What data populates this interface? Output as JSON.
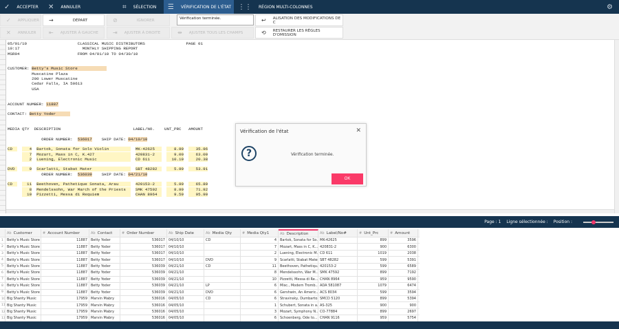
{
  "topbar": {
    "accept": "Accepter",
    "cancel": "Annuler",
    "selection": "Sélection",
    "status_check": "Vérification de l'état",
    "multi_column": "Région multi-colonnes"
  },
  "toolbar": {
    "apply": "Appliquer",
    "start": "Départ",
    "ignore": "Ignorer",
    "status_value": "Vérification terminée.",
    "view_changes": "ALISATION DES MODIFICATIONS DE C",
    "cancel": "Annuler",
    "align_left": "Ajuster à gauche",
    "align_right": "Ajuster à droite",
    "align_all": "Ajuster tous les champs",
    "restore_rules": "Restaurer les règles d'omission"
  },
  "report": [
    [
      [
        "05/01/10                     CLASSICAL MUSIC DISTRIBUTORS                 PAGE 01",
        ""
      ]
    ],
    [
      [
        "10:17                          MONTHLY SHIPPING REPORT",
        ""
      ]
    ],
    [
      [
        "MSR94                        FROM 04/01/10 TO 04/30/10",
        ""
      ]
    ],
    [
      [
        "",
        ""
      ]
    ],
    [
      [
        "",
        ""
      ]
    ],
    [
      [
        "CUSTOMER: ",
        ""
      ],
      [
        "Betty's Music Store            ",
        "hp"
      ]
    ],
    [
      [
        "          Muscatine Plaza",
        ""
      ]
    ],
    [
      [
        "          200 Lower Muscatine",
        ""
      ]
    ],
    [
      [
        "          Cedar Falls, IA 50613",
        ""
      ]
    ],
    [
      [
        "          USA",
        ""
      ]
    ],
    [
      [
        "",
        ""
      ]
    ],
    [
      [
        "",
        ""
      ]
    ],
    [
      [
        "ACCOUNT NUMBER: ",
        ""
      ],
      [
        "11887",
        "hp"
      ]
    ],
    [
      [
        "",
        ""
      ]
    ],
    [
      [
        "CONTACT: ",
        ""
      ],
      [
        "Betty Yoder      ",
        "hp"
      ]
    ],
    [
      [
        "",
        ""
      ]
    ],
    [
      [
        "",
        ""
      ]
    ],
    [
      [
        "MEDIA QTY  DESCRIPTION                              LABEL/NO.    UNT_PRC   AMOUNT",
        ""
      ]
    ],
    [
      [
        "",
        ""
      ]
    ],
    [
      [
        "              ORDER NUMBER:  ",
        ""
      ],
      [
        "536017",
        "hp"
      ],
      [
        "    SHIP DATE: ",
        ""
      ],
      [
        "04/10/10",
        "hp"
      ]
    ],
    [
      [
        "",
        ""
      ]
    ],
    [
      [
        "CD  ",
        "hy"
      ],
      [
        "  ",
        ""
      ],
      [
        "   4",
        "hy"
      ],
      [
        "  ",
        ""
      ],
      [
        "Bartok, Sonata for Solo Violin         ",
        "hy"
      ],
      [
        "  ",
        ""
      ],
      [
        "MK-42625   ",
        "hy"
      ],
      [
        "  ",
        ""
      ],
      [
        "   8.99",
        "hy"
      ],
      [
        "  ",
        ""
      ],
      [
        "   35.96",
        "hy"
      ]
    ],
    [
      [
        "    ",
        ""
      ],
      [
        "  ",
        ""
      ],
      [
        "   7",
        "hy"
      ],
      [
        "  ",
        ""
      ],
      [
        "Mozart, Mass in C, K.427               ",
        "hy"
      ],
      [
        "  ",
        ""
      ],
      [
        "420831-2   ",
        "hy"
      ],
      [
        "  ",
        ""
      ],
      [
        "   9.00",
        "hy"
      ],
      [
        "  ",
        ""
      ],
      [
        "   63.00",
        "hy"
      ]
    ],
    [
      [
        "    ",
        ""
      ],
      [
        "  ",
        ""
      ],
      [
        "   2",
        "hy"
      ],
      [
        "  ",
        ""
      ],
      [
        "Luening, Electronic Music              ",
        "hy"
      ],
      [
        "  ",
        ""
      ],
      [
        "CD 611     ",
        "hy"
      ],
      [
        "  ",
        ""
      ],
      [
        "  10.19",
        "hy"
      ],
      [
        "  ",
        ""
      ],
      [
        "   20.38",
        "hy"
      ]
    ],
    [
      [
        "",
        ""
      ]
    ],
    [
      [
        "DVD ",
        "hy"
      ],
      [
        "  ",
        ""
      ],
      [
        "   9",
        "hy"
      ],
      [
        "  ",
        ""
      ],
      [
        "Scarlatti, Stabat Mater                ",
        "hy"
      ],
      [
        "  ",
        ""
      ],
      [
        "SBT 48282  ",
        "hy"
      ],
      [
        "  ",
        ""
      ],
      [
        "   5.99",
        "hy"
      ],
      [
        "  ",
        ""
      ],
      [
        "   53.91",
        "hy"
      ]
    ],
    [
      [
        "              ORDER NUMBER:  ",
        ""
      ],
      [
        "536039",
        "hp"
      ],
      [
        "    SHIP DATE: ",
        ""
      ],
      [
        "04/21/10",
        "hp"
      ]
    ],
    [
      [
        "",
        ""
      ]
    ],
    [
      [
        "CD  ",
        "hy"
      ],
      [
        "  ",
        ""
      ],
      [
        "  11",
        "hy"
      ],
      [
        "  ",
        ""
      ],
      [
        "Beethoven, Pathetique Sonata, Arau     ",
        "hy"
      ],
      [
        "  ",
        ""
      ],
      [
        "420153-2   ",
        "hy"
      ],
      [
        "  ",
        ""
      ],
      [
        "   5.99",
        "hy"
      ],
      [
        "  ",
        ""
      ],
      [
        "   65.89",
        "hy"
      ]
    ],
    [
      [
        "    ",
        ""
      ],
      [
        "  ",
        ""
      ],
      [
        "   8",
        "hy"
      ],
      [
        "  ",
        ""
      ],
      [
        "Mendelssohn, War March of the Priests  ",
        "hy"
      ],
      [
        "  ",
        ""
      ],
      [
        "SMK 47592  ",
        "hy"
      ],
      [
        "  ",
        ""
      ],
      [
        "   8.99",
        "hy"
      ],
      [
        "  ",
        ""
      ],
      [
        "   71.92",
        "hy"
      ]
    ],
    [
      [
        "    ",
        ""
      ],
      [
        "  ",
        ""
      ],
      [
        "  10",
        "hy"
      ],
      [
        "  ",
        ""
      ],
      [
        "Pizzetti, Messa di Requiem             ",
        "hy"
      ],
      [
        "  ",
        ""
      ],
      [
        "CHAN 8964  ",
        "hy"
      ],
      [
        "  ",
        ""
      ],
      [
        "   9.59",
        "hy"
      ],
      [
        "  ",
        ""
      ],
      [
        "   95.90",
        "hy"
      ]
    ]
  ],
  "dialog": {
    "title": "Vérification de l'état",
    "message": "Vérification terminée.",
    "ok": "OK"
  },
  "status": {
    "page": "Page : 1",
    "selected_row": "Ligne sélectionnée :",
    "position": "Position :"
  },
  "grid": {
    "columns": [
      {
        "t": "Ab",
        "n": "Customer"
      },
      {
        "t": "#",
        "n": "Account Number"
      },
      {
        "t": "Ab",
        "n": "Contact"
      },
      {
        "t": "#",
        "n": "Order Number"
      },
      {
        "t": "Ab",
        "n": "Ship Date"
      },
      {
        "t": "Ab",
        "n": "Media Qty"
      },
      {
        "t": "#",
        "n": "Media Qty1"
      },
      {
        "t": "Ab",
        "n": "Description"
      },
      {
        "t": "Ab",
        "n": "Label/No#"
      },
      {
        "t": "#",
        "n": "Unt_Prc"
      },
      {
        "t": "#",
        "n": "Amount"
      }
    ],
    "rows": [
      [
        "1",
        "Betty's Music Store",
        "11887",
        "Betty Yoder",
        "536017",
        "04/10/10",
        "CD",
        "4",
        "Bartok, Sonata for So...",
        "MK-42625",
        "899",
        "3596"
      ],
      [
        "2",
        "Betty's Music Store",
        "11887",
        "Betty Yoder",
        "536017",
        "04/10/10",
        "",
        "7",
        "Mozart, Mass in C, K...",
        "420831-2",
        "900",
        "6300"
      ],
      [
        "3",
        "Betty's Music Store",
        "11887",
        "Betty Yoder",
        "536017",
        "04/10/10",
        "",
        "2",
        "Luening, Electronic M...",
        "CD 611",
        "1019",
        "2038"
      ],
      [
        "4",
        "Betty's Music Store",
        "11887",
        "Betty Yoder",
        "536017",
        "04/10/10",
        "DVD",
        "9",
        "Scarlatti, Stabat Mater",
        "SBT 48282",
        "599",
        "5391"
      ],
      [
        "5",
        "Betty's Music Store",
        "11887",
        "Betty Yoder",
        "536039",
        "04/21/10",
        "CD",
        "11",
        "Beethoven, Pathetiqu...",
        "420153-2",
        "599",
        "6589"
      ],
      [
        "6",
        "Betty's Music Store",
        "11887",
        "Betty Yoder",
        "536039",
        "04/21/10",
        "",
        "8",
        "Mendelssohn, War M...",
        "SMK 47592",
        "899",
        "7192"
      ],
      [
        "7",
        "Betty's Music Store",
        "11887",
        "Betty Yoder",
        "536039",
        "04/21/10",
        "",
        "10",
        "Pizzetti, Messa di Re...",
        "CHAN 8964",
        "959",
        "9590"
      ],
      [
        "8",
        "Betty's Music Store",
        "11887",
        "Betty Yoder",
        "536039",
        "04/21/10",
        "LP",
        "6",
        "Misc., Modern Tromb...",
        "ADA 581087",
        "1079",
        "6474"
      ],
      [
        "9",
        "Betty's Music Store",
        "11887",
        "Betty Yoder",
        "536039",
        "04/21/10",
        "DVD",
        "6",
        "Gershwin, An Americ...",
        "ACS 8034",
        "599",
        "3594"
      ],
      [
        "10",
        "Big Shanty Music",
        "17959",
        "Marvin Mabry",
        "536016",
        "04/05/10",
        "CD",
        "6",
        "Stravinsky, Dumbarto...",
        "SMCD 5120",
        "899",
        "5394"
      ],
      [
        "11",
        "Big Shanty Music",
        "17959",
        "Marvin Mabry",
        "536016",
        "04/05/10",
        "",
        "1",
        "Schubert, Sonata in a...",
        "AS-325",
        "900",
        "900"
      ],
      [
        "12",
        "Big Shanty Music",
        "17959",
        "Marvin Mabry",
        "536016",
        "04/05/10",
        "",
        "3",
        "Mozart, Symphony N...",
        "CO-77884",
        "899",
        "2697"
      ],
      [
        "13",
        "Big Shanty Music",
        "17959",
        "Marvin Mabry",
        "536016",
        "04/05/10",
        "",
        "6",
        "Schoenberg, Ode to...",
        "CHAN 9116",
        "959",
        "5754"
      ]
    ]
  },
  "colors": {
    "navy": "#15344f",
    "active_tab": "#2c5d8f",
    "accent": "#fa3a68",
    "field_highlight": "#f6dcb5",
    "row_highlight": "#fff6c4"
  }
}
